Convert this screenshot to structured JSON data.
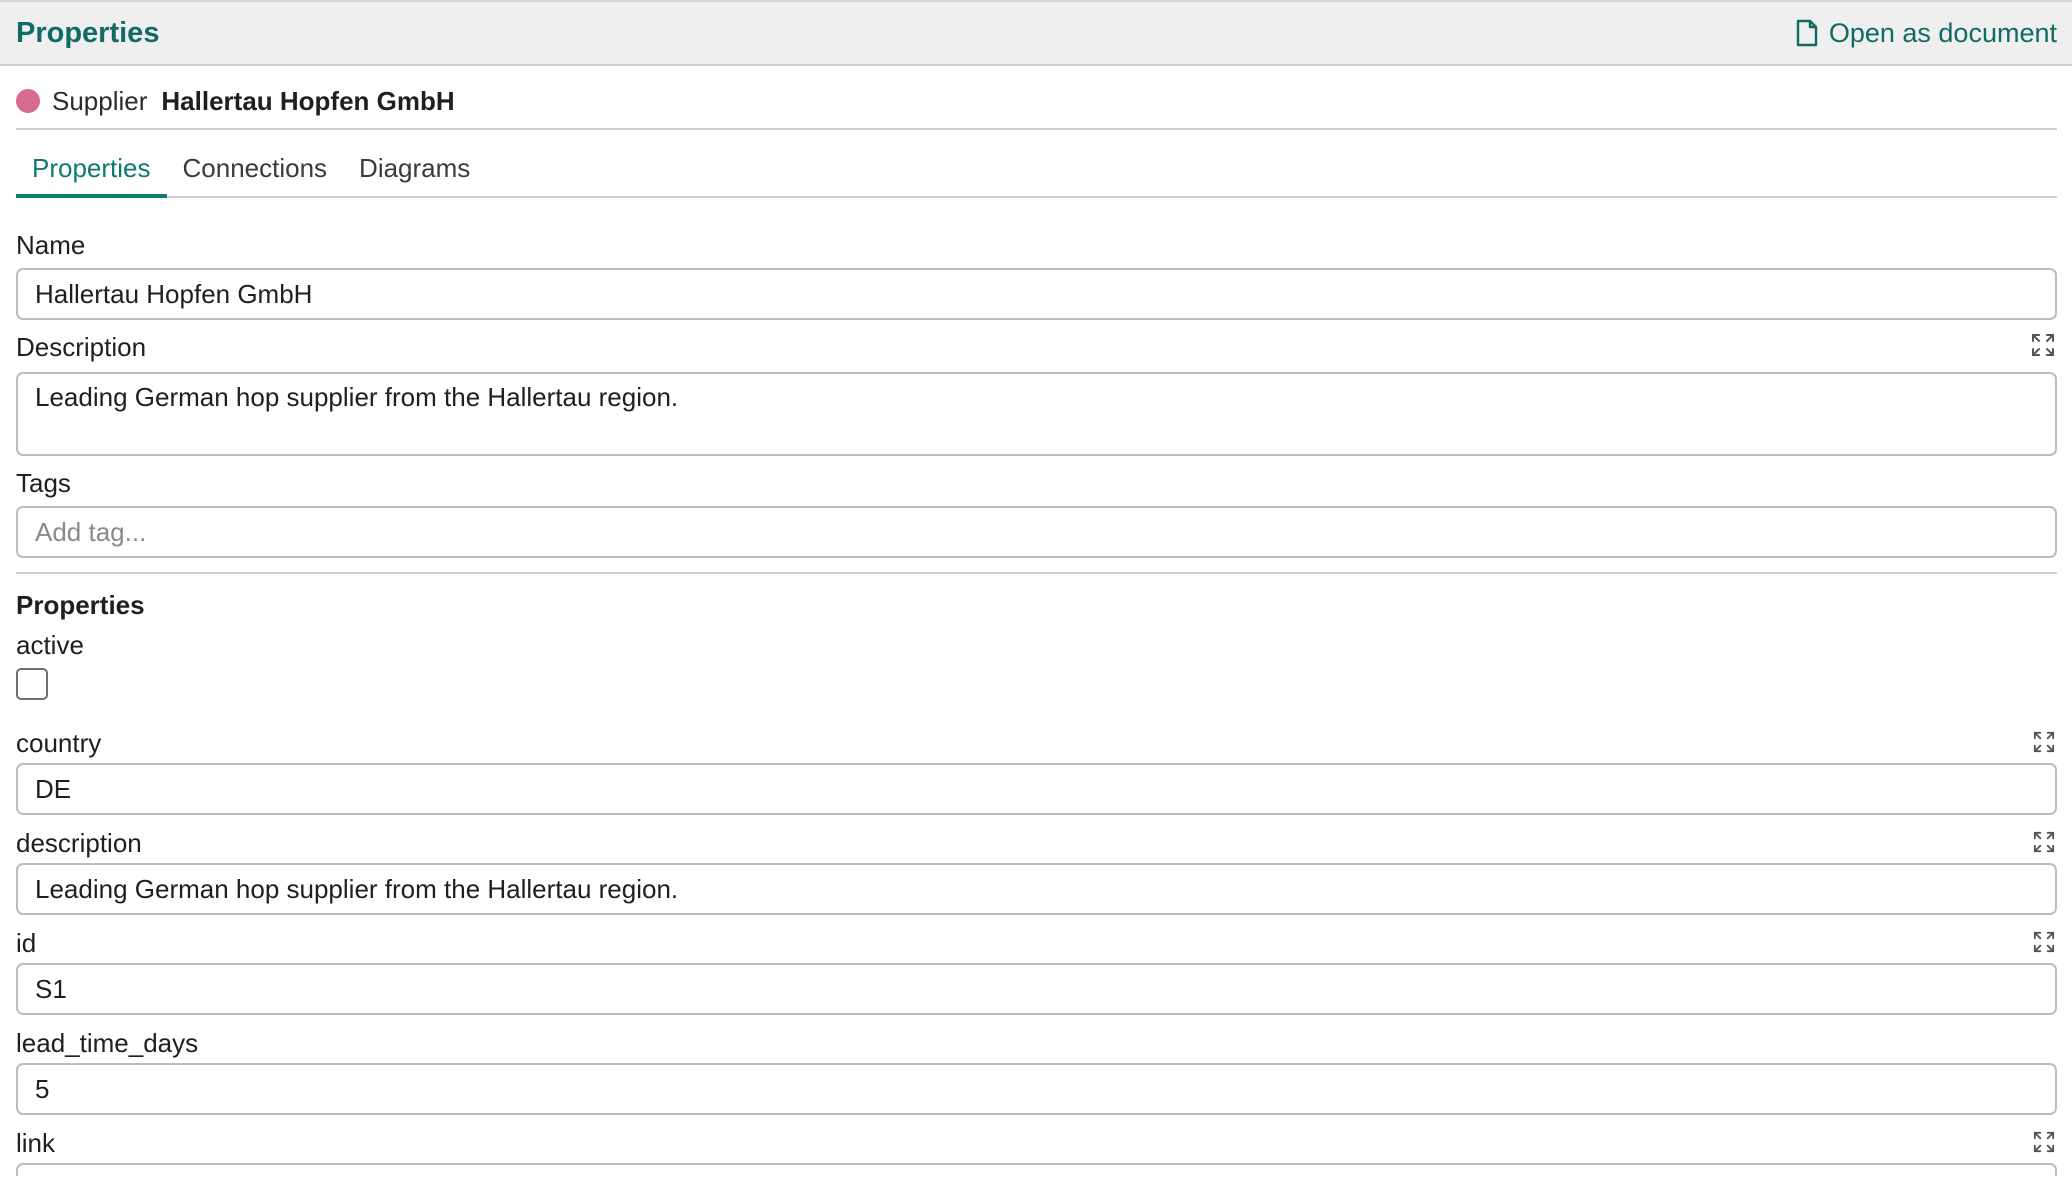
{
  "header": {
    "title": "Properties",
    "open_document_label": "Open as document"
  },
  "entity": {
    "type": "Supplier",
    "name": "Hallertau Hopfen GmbH",
    "dot_color": "#d66b8f"
  },
  "tabs": [
    {
      "label": "Properties",
      "active": true
    },
    {
      "label": "Connections",
      "active": false
    },
    {
      "label": "Diagrams",
      "active": false
    }
  ],
  "form": {
    "name_label": "Name",
    "name_value": "Hallertau Hopfen GmbH",
    "description_label": "Description",
    "description_value": "Leading German hop supplier from the Hallertau region.",
    "tags_label": "Tags",
    "tags_placeholder": "Add tag..."
  },
  "properties": {
    "section_title": "Properties",
    "active_label": "active",
    "active_checked": false,
    "country_label": "country",
    "country_value": "DE",
    "description_label": "description",
    "description_value": "Leading German hop supplier from the Hallertau region.",
    "id_label": "id",
    "id_value": "S1",
    "lead_time_label": "lead_time_days",
    "lead_time_value": "5",
    "link_label": "link"
  },
  "colors": {
    "accent": "#0f7a70",
    "header_bg": "#efefef"
  }
}
